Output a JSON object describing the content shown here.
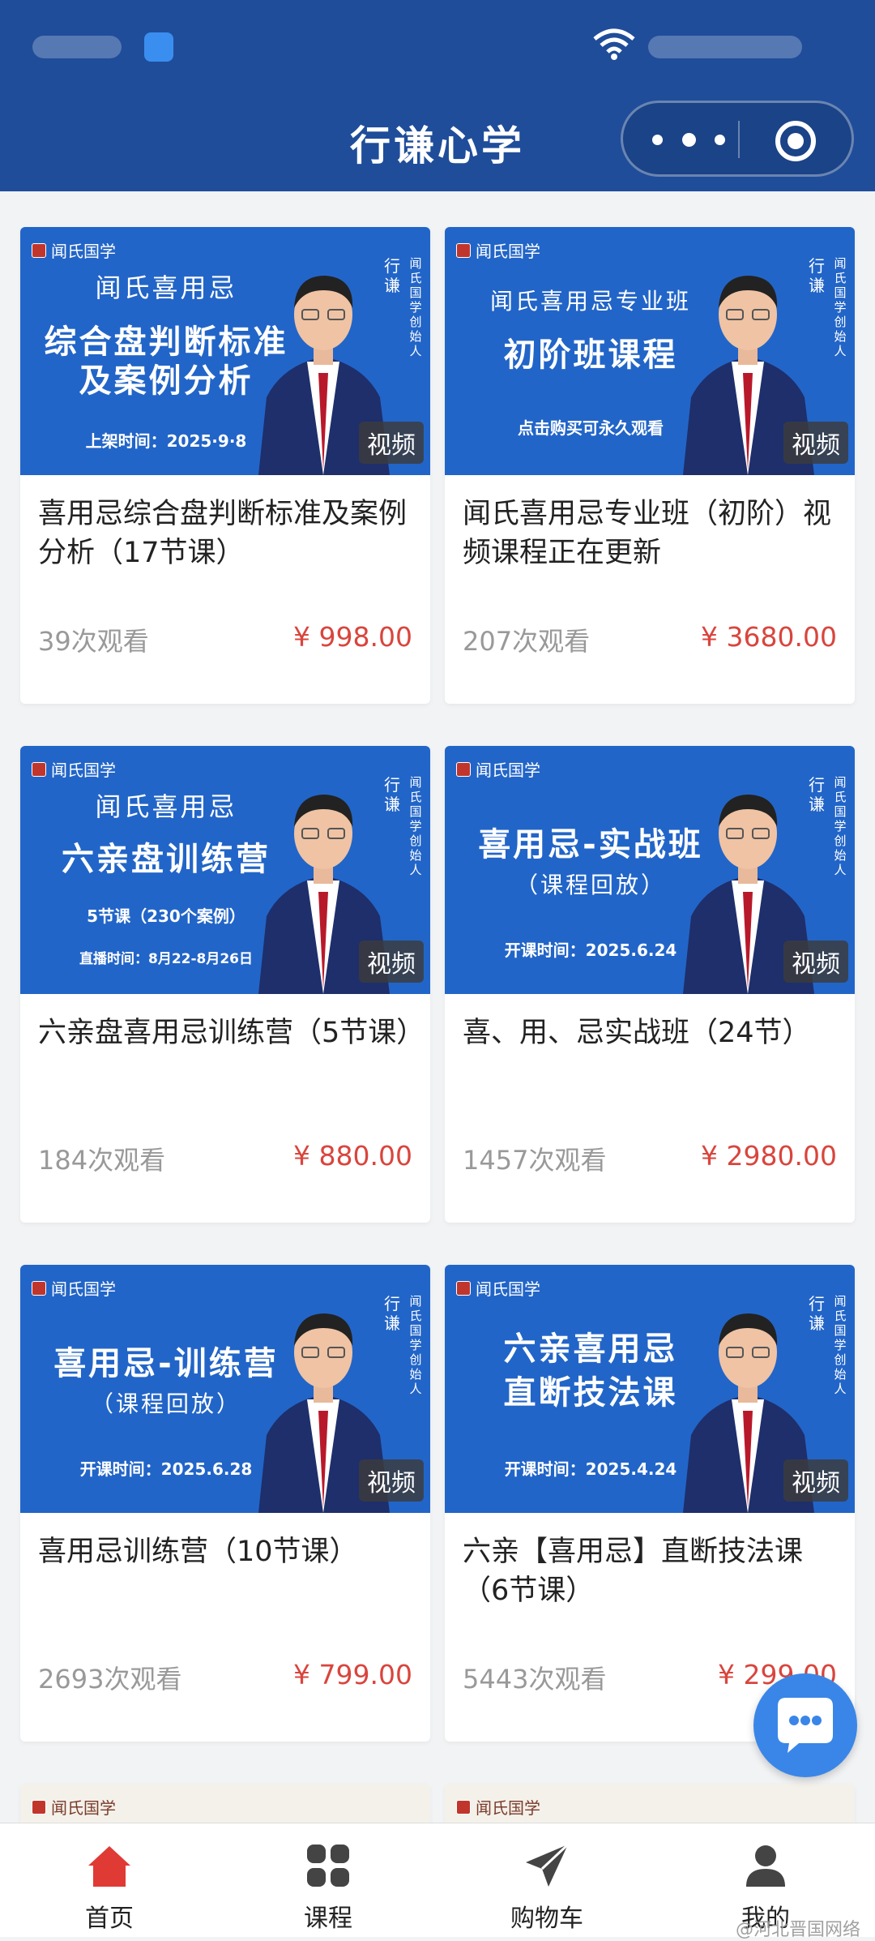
{
  "header": {
    "title": "行谦心学"
  },
  "cards": [
    {
      "brand": "闻氏国学",
      "thumb_line1": "闻氏喜用忌",
      "thumb_big": [
        "综合盘判断标准",
        "及案例分析"
      ],
      "thumb_small": "上架时间：2025·9·8",
      "vert1": "行谦",
      "vert2": "闻氏国学创始人",
      "tag": "视频",
      "title": "喜用忌综合盘判断标准及案例分析（17节课）",
      "views": "39次观看",
      "price": "¥ 998.00"
    },
    {
      "brand": "闻氏国学",
      "thumb_line1": "闻氏喜用忌专业班",
      "thumb_big": [
        "初阶班课程"
      ],
      "thumb_small": "点击购买可永久观看",
      "vert1": "行谦",
      "vert2": "闻氏国学创始人",
      "tag": "视频",
      "title": "闻氏喜用忌专业班（初阶）视频课程正在更新",
      "views": "207次观看",
      "price": "¥ 3680.00"
    },
    {
      "brand": "闻氏国学",
      "thumb_line1": "闻氏喜用忌",
      "thumb_big": [
        "六亲盘训练营"
      ],
      "thumb_small": "5节课（230个案例）",
      "thumb_small2": "直播时间：8月22-8月26日",
      "vert1": "行谦",
      "vert2": "闻氏国学创始人",
      "tag": "视频",
      "title": "六亲盘喜用忌训练营（5节课）",
      "views": "184次观看",
      "price": "¥ 880.00"
    },
    {
      "brand": "闻氏国学",
      "thumb_line1": "",
      "thumb_big": [
        "喜用忌-实战班"
      ],
      "thumb_sub": "（课程回放）",
      "thumb_small": "开课时间：2025.6.24",
      "vert1": "行谦",
      "vert2": "闻氏国学创始人",
      "tag": "视频",
      "title": "喜、用、忌实战班（24节）",
      "views": "1457次观看",
      "price": "¥ 2980.00"
    },
    {
      "brand": "闻氏国学",
      "thumb_line1": "",
      "thumb_big": [
        "喜用忌-训练营"
      ],
      "thumb_sub": "（课程回放）",
      "thumb_small": "开课时间：2025.6.28",
      "vert1": "行谦",
      "vert2": "闻氏国学创始人",
      "tag": "视频",
      "title": "喜用忌训练营（10节课）",
      "views": "2693次观看",
      "price": "¥ 799.00"
    },
    {
      "brand": "闻氏国学",
      "thumb_line1": "",
      "thumb_big": [
        "六亲喜用忌",
        "直断技法课"
      ],
      "thumb_small": "开课时间：2025.4.24",
      "vert1": "行谦",
      "vert2": "闻氏国学创始人",
      "tag": "视频",
      "title": "六亲【喜用忌】直断技法课（6节课）",
      "views": "5443次观看",
      "price": "¥ 299.00"
    },
    {
      "brand": "闻氏国学"
    },
    {
      "brand": "闻氏国学"
    }
  ],
  "tabbar": [
    {
      "label": "首页",
      "icon": "home-icon"
    },
    {
      "label": "课程",
      "icon": "grid-icon"
    },
    {
      "label": "购物车",
      "icon": "send-icon"
    },
    {
      "label": "我的",
      "icon": "user-icon"
    }
  ],
  "watermark": "@河北晋国网络",
  "colors": {
    "header": "#1f4d9a",
    "thumb": "#2265c8",
    "price": "#d9453d",
    "home_active": "#e03a35",
    "chat": "#3a86e8"
  }
}
